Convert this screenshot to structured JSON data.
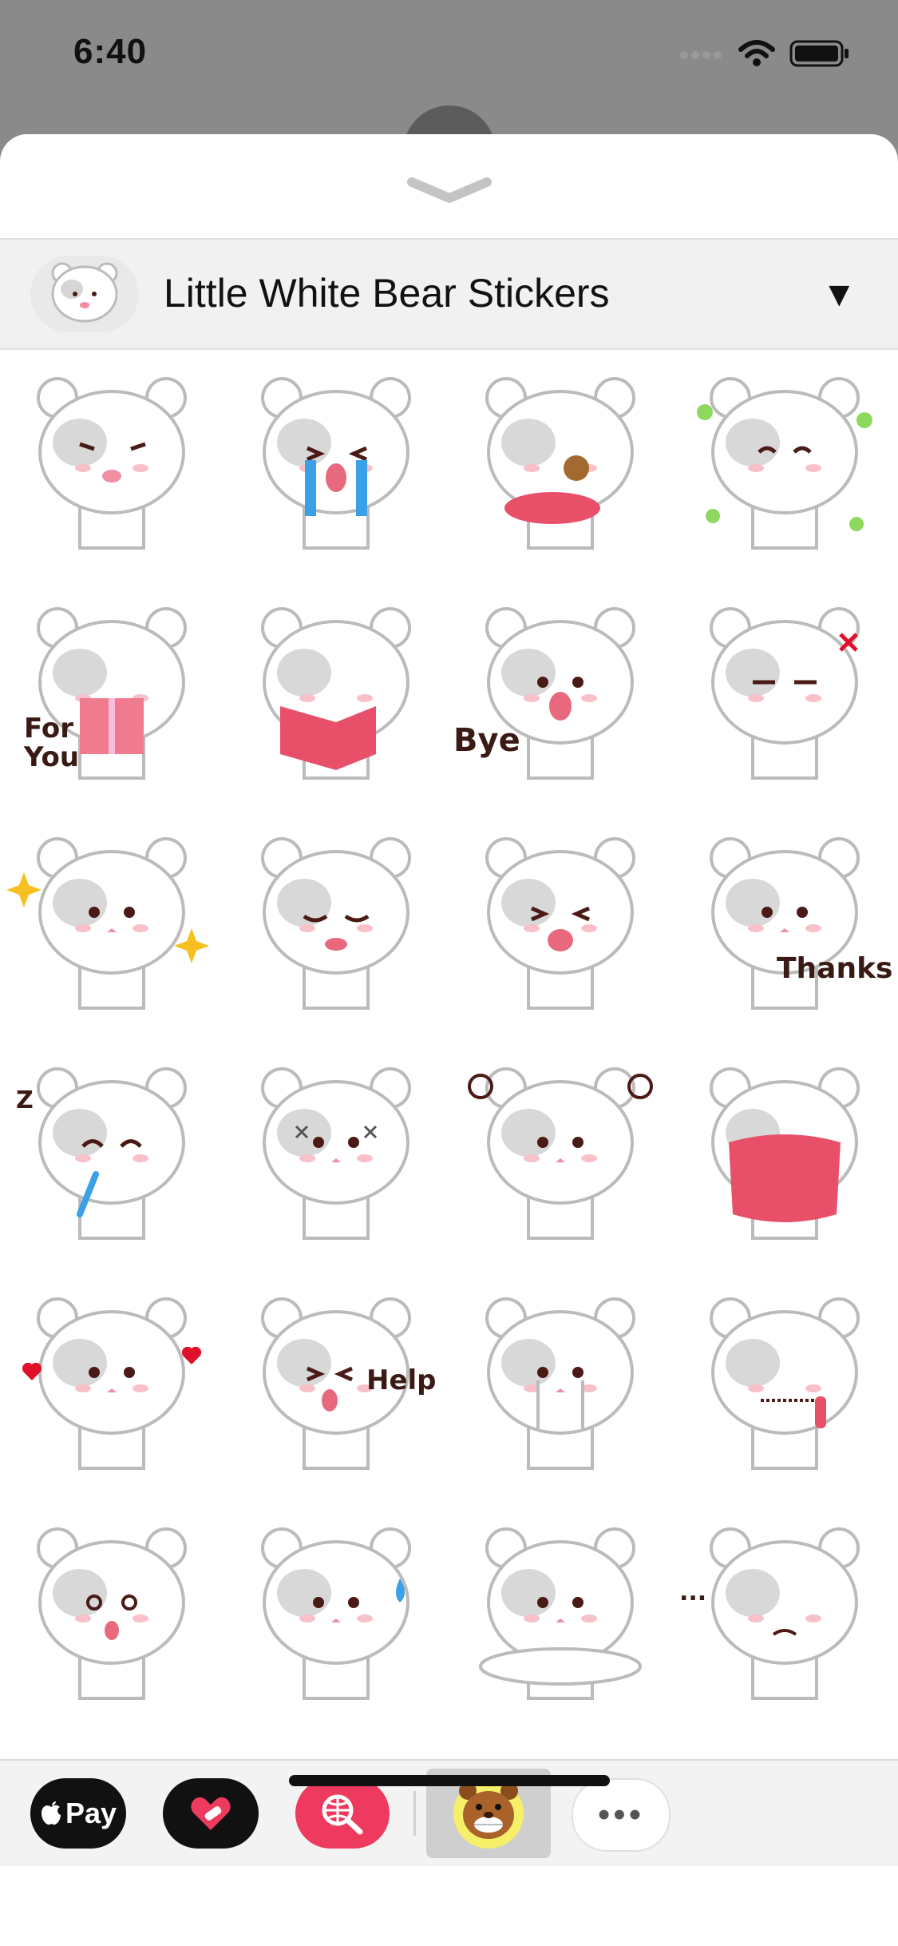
{
  "status_bar": {
    "time": "6:40"
  },
  "sheet": {
    "pack_title": "Little White Bear Stickers",
    "pack_caret": "▼"
  },
  "stickers": [
    {
      "caption": "",
      "mood": "grumpy"
    },
    {
      "caption": "",
      "mood": "crying"
    },
    {
      "caption": "",
      "mood": "cookie"
    },
    {
      "caption": "",
      "mood": "happy"
    },
    {
      "caption": "For You",
      "mood": "gift"
    },
    {
      "caption": "",
      "mood": "reading"
    },
    {
      "caption": "Bye",
      "mood": "wave"
    },
    {
      "caption": "",
      "mood": "annoyed"
    },
    {
      "caption": "",
      "mood": "sparkle"
    },
    {
      "caption": "",
      "mood": "sad"
    },
    {
      "caption": "",
      "mood": "laugh"
    },
    {
      "caption": "Thanks",
      "mood": "thanks"
    },
    {
      "caption": "Z",
      "mood": "sleeping"
    },
    {
      "caption": "",
      "mood": "bruised"
    },
    {
      "caption": "",
      "mood": "confused"
    },
    {
      "caption": "",
      "mood": "pillow"
    },
    {
      "caption": "",
      "mood": "love"
    },
    {
      "caption": "Help",
      "mood": "help"
    },
    {
      "caption": "",
      "mood": "tears"
    },
    {
      "caption": "",
      "mood": "zipped"
    },
    {
      "caption": "",
      "mood": "surprised"
    },
    {
      "caption": "",
      "mood": "sweat"
    },
    {
      "caption": "",
      "mood": "lying"
    },
    {
      "caption": "...",
      "mood": "pondering"
    }
  ],
  "app_drawer": {
    "apple_pay_label": "Pay",
    "more_label": "•••"
  },
  "colors": {
    "sheet_bg": "#ffffff",
    "header_bg": "#f1f1f1",
    "accent_pink": "#ee3a5e",
    "dimmed_bg": "#8a8a8a"
  }
}
